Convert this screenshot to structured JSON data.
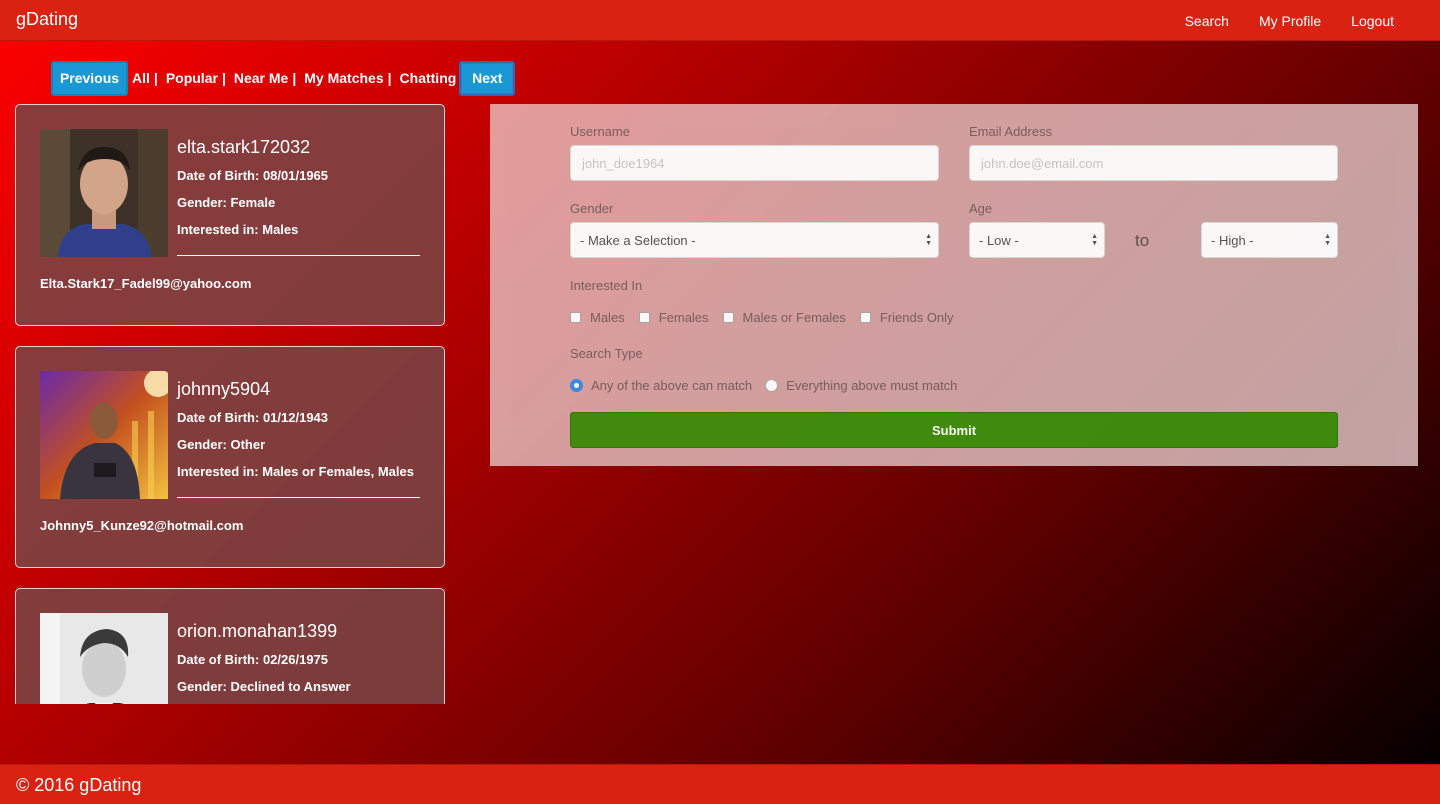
{
  "nav": {
    "brand": "gDating",
    "links": [
      "Search",
      "My Profile",
      "Logout"
    ]
  },
  "filter": {
    "previous": "Previous",
    "next": "Next",
    "links": [
      "All",
      "Popular",
      "Near Me",
      "My Matches",
      "Chatting"
    ],
    "separator": "|"
  },
  "profiles": [
    {
      "username": "elta.stark172032",
      "dob": "Date of Birth: 08/01/1965",
      "gender": "Gender: Female",
      "interested": "Interested in: Males",
      "email": "Elta.Stark17_Fadel99@yahoo.com"
    },
    {
      "username": "johnny5904",
      "dob": "Date of Birth: 01/12/1943",
      "gender": "Gender: Other",
      "interested": "Interested in: Males or Females, Males",
      "email": "Johnny5_Kunze92@hotmail.com"
    },
    {
      "username": "orion.monahan1399",
      "dob": "Date of Birth: 02/26/1975",
      "gender": "Gender: Declined to Answer"
    }
  ],
  "search": {
    "username_label": "Username",
    "username_placeholder": "john_doe1964",
    "email_label": "Email Address",
    "email_placeholder": "john.doe@email.com",
    "gender_label": "Gender",
    "gender_value": "- Make a Selection -",
    "age_label": "Age",
    "age_low": "- Low -",
    "age_to": "to",
    "age_high": "- High -",
    "interested_label": "Interested In",
    "interested_options": [
      "Males",
      "Females",
      "Males or Females",
      "Friends Only"
    ],
    "search_type_label": "Search Type",
    "search_type_options": [
      "Any of the above can match",
      "Everything above must match"
    ],
    "search_type_selected": 0,
    "submit": "Submit"
  },
  "footer": {
    "text": "© 2016 gDating"
  },
  "colors": {
    "navbar": "#d92211",
    "button_blue": "#1a98d5",
    "submit_green": "#3f8f0e"
  }
}
